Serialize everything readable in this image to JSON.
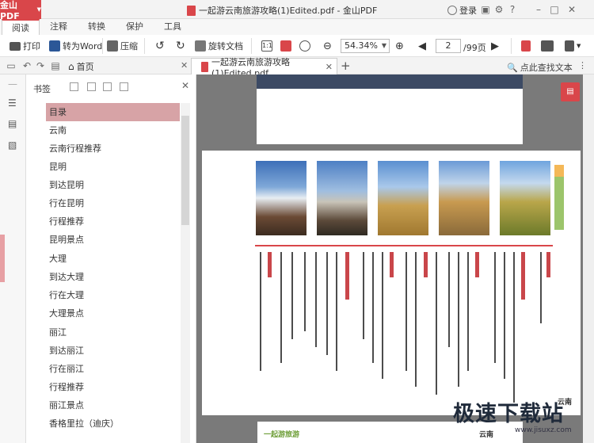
{
  "app": {
    "name": "金山PDF",
    "window_title": "一起游云南旅游攻略(1)Edited.pdf - 金山PDF",
    "login": "登录"
  },
  "menu_tabs": [
    "阅读",
    "注释",
    "转换",
    "保护",
    "工具"
  ],
  "toolbar": {
    "print": "打印",
    "to_word": "转为Word",
    "compress": "压缩",
    "rotate_doc": "旋转文档",
    "zoom": "54.34%",
    "page_current": "2",
    "page_total": "/99页"
  },
  "doc_tabs": {
    "home": "首页",
    "file": "一起游云南旅游攻略(1)Edited.pdf",
    "search": "点此查找文本"
  },
  "bookmarks": {
    "title": "书签",
    "items": [
      "目录",
      "云南",
      "云南行程推荐",
      "昆明",
      "到达昆明",
      "行在昆明",
      "行程推荐",
      "昆明景点",
      "大理",
      "到达大理",
      "行在大理",
      "大理景点",
      "丽江",
      "到达丽江",
      "行在丽江",
      "行程推荐",
      "丽江景点",
      "香格里拉（迪庆）"
    ]
  },
  "page_labels": {
    "vertical_yn": "云南",
    "p3_logo": "一起游旅游",
    "p3_text": "云南"
  },
  "watermark": {
    "text": "极速下载站",
    "url": "www.jisuxz.com"
  },
  "colors": {
    "accent": "#d9464a",
    "selected_bookmark": "#d7a3a6",
    "viewer_bg": "#7a7a7a"
  }
}
